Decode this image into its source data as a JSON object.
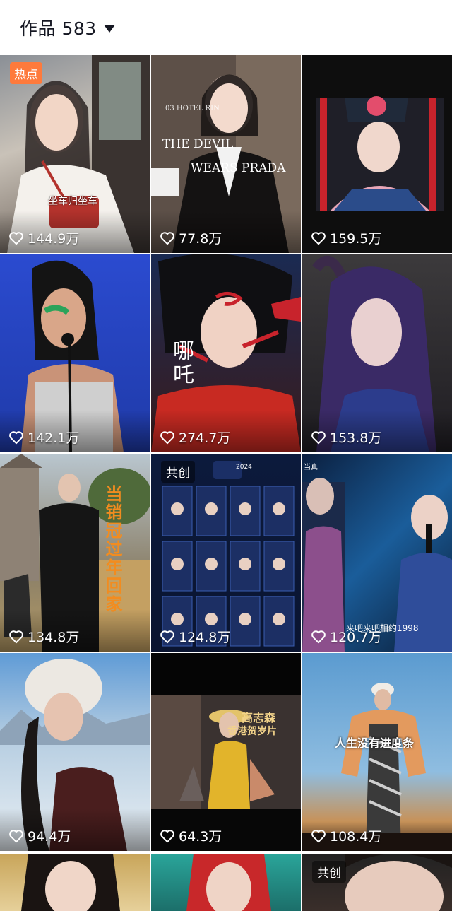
{
  "header": {
    "title": "作品 583"
  },
  "colors": {
    "hot_tag": "#fe7a3c",
    "text_dark": "#161823"
  },
  "videos": [
    {
      "likes": "144.9万",
      "tag": "热点",
      "caption": "坐车归坐车"
    },
    {
      "likes": "77.8万",
      "overlay_line1": "THE DEVIL",
      "overlay_line2": "WEARS PRADA",
      "overlay_small": "03 HOTEL RIN"
    },
    {
      "likes": "159.5万"
    },
    {
      "likes": "142.1万"
    },
    {
      "likes": "274.7万",
      "overlay_vertical": "哪吒"
    },
    {
      "likes": "153.8万"
    },
    {
      "likes": "134.8万",
      "overlay_vertical": "当销冠过年回家"
    },
    {
      "likes": "124.8万",
      "tag": "共创",
      "overlay_small": "2024"
    },
    {
      "likes": "120.7万",
      "caption": "来吧来吧相约1998",
      "overlay_small": "当真"
    },
    {
      "likes": "94.4万"
    },
    {
      "likes": "64.3万",
      "overlay_line1": "高志森",
      "overlay_line2": "香港贺岁片"
    },
    {
      "likes": "108.4万",
      "overlay_line1": "人生没有进度条"
    },
    {
      "likes": ""
    },
    {
      "likes": ""
    },
    {
      "likes": "",
      "tag": "共创"
    }
  ]
}
